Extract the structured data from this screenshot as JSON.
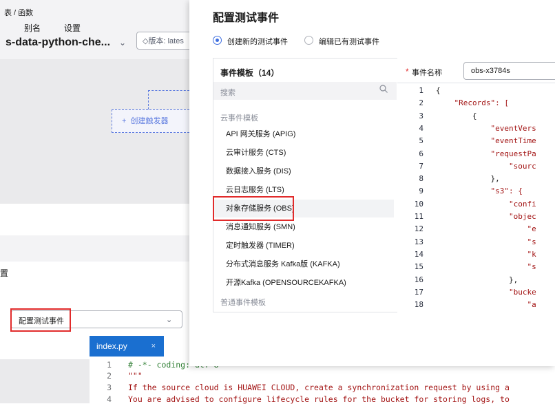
{
  "background": {
    "breadcrumb": "表 / 函数",
    "function_name": "s-data-python-che...",
    "version_label": "版本: lates",
    "create_trigger": "创建触发器",
    "tabs": [
      "别名",
      "设置"
    ],
    "panel_title": "置",
    "test_event_select": "配置测试事件",
    "editor": {
      "file_tab": "index.py",
      "close": "×",
      "lines": [
        {
          "n": "1",
          "text": "# -*- coding: utf-8 -*-"
        },
        {
          "n": "2",
          "text": "\"\"\""
        },
        {
          "n": "3",
          "text": "If the source cloud is HUAWEI CLOUD, create a synchronization request by using a"
        },
        {
          "n": "4",
          "text": "You are advised to configure lifecycle rules for the bucket for storing logs, to"
        }
      ]
    }
  },
  "modal": {
    "title": "配置测试事件",
    "radio_new": "创建新的测试事件",
    "radio_existing": "编辑已有测试事件",
    "template_header": "事件模板（14）",
    "search_placeholder": "搜索",
    "group_cloud": "云事件模板",
    "group_normal": "普通事件模板",
    "templates": [
      "API 网关服务 (APIG)",
      "云审计服务 (CTS)",
      "数据接入服务 (DIS)",
      "云日志服务 (LTS)",
      "对象存储服务 (OBS)",
      "消息通知服务 (SMN)",
      "定时触发器 (TIMER)",
      "分布式消息服务 Kafka版 (KAFKA)",
      "开源Kafka (OPENSOURCEKAFKA)"
    ],
    "selected_template": "对象存储服务 (OBS)",
    "event_name_label": "事件名称",
    "event_name_value": "obs-x3784s",
    "code_lines": [
      {
        "n": "1",
        "text": "{"
      },
      {
        "n": "2",
        "text": "    \"Records\": ["
      },
      {
        "n": "3",
        "text": "        {"
      },
      {
        "n": "4",
        "text": "            \"eventVers"
      },
      {
        "n": "5",
        "text": "            \"eventTime"
      },
      {
        "n": "6",
        "text": "            \"requestPa"
      },
      {
        "n": "7",
        "text": "                \"sourc"
      },
      {
        "n": "8",
        "text": "            },"
      },
      {
        "n": "9",
        "text": "            \"s3\": {"
      },
      {
        "n": "10",
        "text": "                \"confi"
      },
      {
        "n": "11",
        "text": "                \"objec"
      },
      {
        "n": "12",
        "text": "                    \"e"
      },
      {
        "n": "13",
        "text": "                    \"s"
      },
      {
        "n": "14",
        "text": "                    \"k"
      },
      {
        "n": "15",
        "text": "                    \"s"
      },
      {
        "n": "16",
        "text": "                },"
      },
      {
        "n": "17",
        "text": "                \"bucke"
      },
      {
        "n": "18",
        "text": "                    \"a"
      }
    ]
  },
  "colors": {
    "accent": "#3f6fe0",
    "highlight": "#e12b2b",
    "tab_blue": "#1a6fd0"
  }
}
